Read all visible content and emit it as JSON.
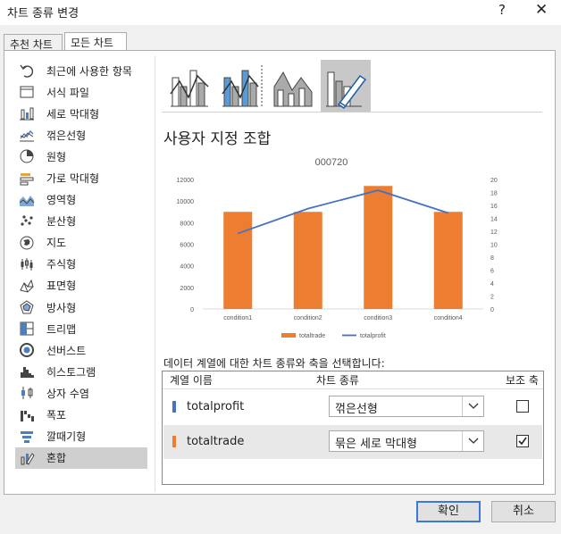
{
  "window": {
    "title": "차트 종류 변경",
    "help": "?",
    "close": "✕"
  },
  "tabs": [
    "추천 차트",
    "모든 차트"
  ],
  "chart_types": [
    {
      "label": "최근에 사용한 항목",
      "icon": "undo-icon"
    },
    {
      "label": "서식 파일",
      "icon": "folder-icon"
    },
    {
      "label": "세로 막대형",
      "icon": "column-chart-icon"
    },
    {
      "label": "꺾은선형",
      "icon": "line-chart-icon"
    },
    {
      "label": "원형",
      "icon": "pie-chart-icon"
    },
    {
      "label": "가로 막대형",
      "icon": "bar-chart-icon"
    },
    {
      "label": "영역형",
      "icon": "area-chart-icon"
    },
    {
      "label": "분산형",
      "icon": "scatter-chart-icon"
    },
    {
      "label": "지도",
      "icon": "map-globe-icon"
    },
    {
      "label": "주식형",
      "icon": "stock-chart-icon"
    },
    {
      "label": "표면형",
      "icon": "surface-chart-icon"
    },
    {
      "label": "방사형",
      "icon": "radar-chart-icon"
    },
    {
      "label": "트리맵",
      "icon": "treemap-icon"
    },
    {
      "label": "선버스트",
      "icon": "sunburst-icon"
    },
    {
      "label": "히스토그램",
      "icon": "histogram-icon"
    },
    {
      "label": "상자 수염",
      "icon": "box-whisker-icon"
    },
    {
      "label": "폭포",
      "icon": "waterfall-icon"
    },
    {
      "label": "깔때기형",
      "icon": "funnel-icon"
    },
    {
      "label": "혼합",
      "icon": "combo-chart-icon"
    }
  ],
  "selected_type": "혼합",
  "subtype_title": "사용자 지정 조합",
  "series_prompt": "데이터 계열에 대한 차트 종류와 축을 선택합니다:",
  "series_table": {
    "headers": {
      "name": "계열 이름",
      "type": "차트 종류",
      "secondary": "보조 축"
    },
    "rows": [
      {
        "name": "totalprofit",
        "color": "#4472c4",
        "type": "꺾은선형",
        "secondary": false
      },
      {
        "name": "totaltrade",
        "color": "#ed7d31",
        "type": "묶은 세로 막대형",
        "secondary": true
      }
    ]
  },
  "buttons": {
    "ok": "확인",
    "cancel": "취소"
  },
  "chart_data": {
    "type": "bar",
    "title": "000720",
    "categories": [
      "condition1",
      "condition2",
      "condition3",
      "condition4"
    ],
    "series": [
      {
        "name": "totaltrade",
        "type": "bar",
        "axis": "secondary",
        "color": "#ed7d31",
        "values": [
          15,
          15,
          19,
          15
        ]
      },
      {
        "name": "totalprofit",
        "type": "line",
        "axis": "primary",
        "color": "#4472c4",
        "values": [
          7000,
          9300,
          11000,
          8900
        ]
      }
    ],
    "y_primary": {
      "ticks": [
        "0",
        "2000",
        "4000",
        "6000",
        "8000",
        "10000",
        "12000"
      ],
      "range": [
        0,
        12000
      ]
    },
    "y_secondary": {
      "ticks": [
        "0",
        "2",
        "4",
        "6",
        "8",
        "10",
        "12",
        "14",
        "16",
        "18",
        "20"
      ],
      "range": [
        0,
        20
      ]
    },
    "legend": [
      "totaltrade",
      "totalprofit"
    ],
    "legend_position": "bottom",
    "grid": false
  }
}
